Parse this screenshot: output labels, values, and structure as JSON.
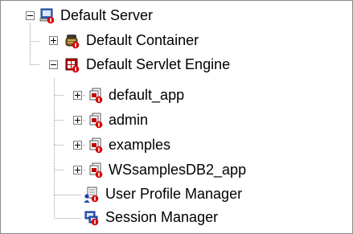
{
  "tree": {
    "root": {
      "label": "Default Server",
      "icon": "server-icon",
      "expanded": true
    },
    "children": [
      {
        "label": "Default Container",
        "icon": "container-icon",
        "expanded": false
      },
      {
        "label": "Default Servlet Engine",
        "icon": "servlet-engine-icon",
        "expanded": true,
        "children": [
          {
            "label": "default_app",
            "icon": "web-app-icon",
            "expanded": false
          },
          {
            "label": "admin",
            "icon": "web-app-icon",
            "expanded": false
          },
          {
            "label": "examples",
            "icon": "web-app-icon",
            "expanded": false
          },
          {
            "label": "WSsamplesDB2_app",
            "icon": "web-app-icon",
            "expanded": false
          }
        ]
      },
      {
        "label": "User Profile Manager",
        "icon": "user-profile-icon"
      },
      {
        "label": "Session Manager",
        "icon": "session-manager-icon"
      }
    ]
  }
}
